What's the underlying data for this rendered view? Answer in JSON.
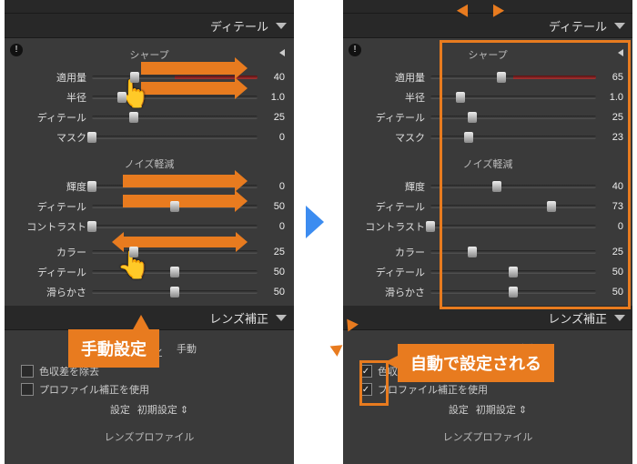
{
  "headers": {
    "detail": "ディテール",
    "lens": "レンズ補正"
  },
  "groups": {
    "sharpen": "シャープ",
    "noise": "ノイズ軽減"
  },
  "labels": {
    "amount": "適用量",
    "radius": "半径",
    "detail": "ディテール",
    "mask": "マスク",
    "luminance": "輝度",
    "contrast": "コントラスト",
    "color": "カラー",
    "smooth": "滑らかさ"
  },
  "left": {
    "sharpen": {
      "amount": "40",
      "radius": "1.0",
      "detail": "25",
      "mask": "0"
    },
    "noise": {
      "luminance": "0",
      "n_detail": "50",
      "contrast": "0",
      "color": "25",
      "c_detail": "50",
      "smooth": "50"
    }
  },
  "right": {
    "sharpen": {
      "amount": "65",
      "radius": "1.0",
      "detail": "25",
      "mask": "23"
    },
    "noise": {
      "luminance": "40",
      "n_detail": "73",
      "contrast": "0",
      "color": "25",
      "c_detail": "50",
      "smooth": "50"
    }
  },
  "lens": {
    "tab_profile": "プロファイル",
    "tab_manual": "手動",
    "chk_chroma": "色収差を除去",
    "chk_profile": "プロファイル補正を使用",
    "settings_label": "設定",
    "settings_value": "初期設定",
    "lens_profile": "レンズプロファイル"
  },
  "callouts": {
    "manual": "手動設定",
    "auto": "自動で設定される"
  }
}
